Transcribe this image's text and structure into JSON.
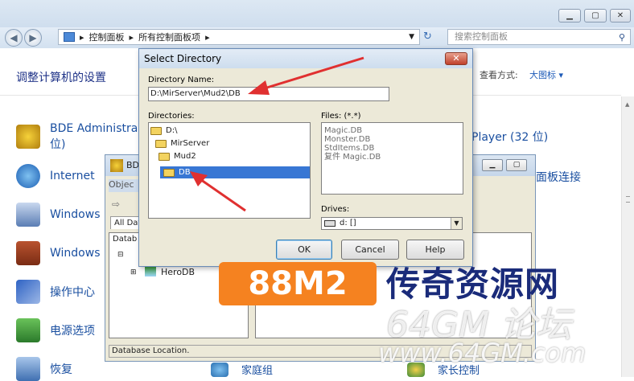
{
  "control_panel": {
    "address_path": [
      "控制面板",
      "所有控制面板项"
    ],
    "search_placeholder": "搜索控制面板",
    "heading": "调整计算机的设置",
    "view_by_label": "查看方式:",
    "view_by_value": "大图标 ▾",
    "items_left": [
      "BDE Administra",
      "位)",
      "Internet",
      "Windows",
      "Windows",
      "操作中心",
      "电源选项",
      "恢复"
    ],
    "items_right": [
      "Player (32 位)",
      "面板连接",
      "家庭组",
      "家长控制"
    ]
  },
  "bde_window": {
    "title": "BDE",
    "tab_object": "Objec",
    "tab_all": "All Data",
    "panel_header": "Datab",
    "tree_item": "HeroDB",
    "status": "Database Location."
  },
  "dialog": {
    "title": "Select Directory",
    "close": "✕",
    "directory_name_label": "Directory Name:",
    "directory_name_value": "D:\\MirServer\\Mud2\\DB",
    "directories_label": "Directories:",
    "directories": [
      "D:\\",
      "MirServer",
      "Mud2",
      "DB"
    ],
    "files_label": "Files: (*.*)",
    "files": [
      "Magic.DB",
      "Monster.DB",
      "StdItems.DB",
      "复件 Magic.DB"
    ],
    "drives_label": "Drives:",
    "drive_value": "d: []",
    "ok": "OK",
    "cancel": "Cancel",
    "help": "Help"
  },
  "watermark": {
    "badge": "88M2",
    "text": "传奇资源网",
    "sub": "64GM 论坛",
    "url": "www.64GM.com"
  },
  "colors": {
    "accent_link": "#1e3287",
    "selection": "#3877d4",
    "arrow": "#e03030",
    "watermark_orange": "#f58220"
  }
}
